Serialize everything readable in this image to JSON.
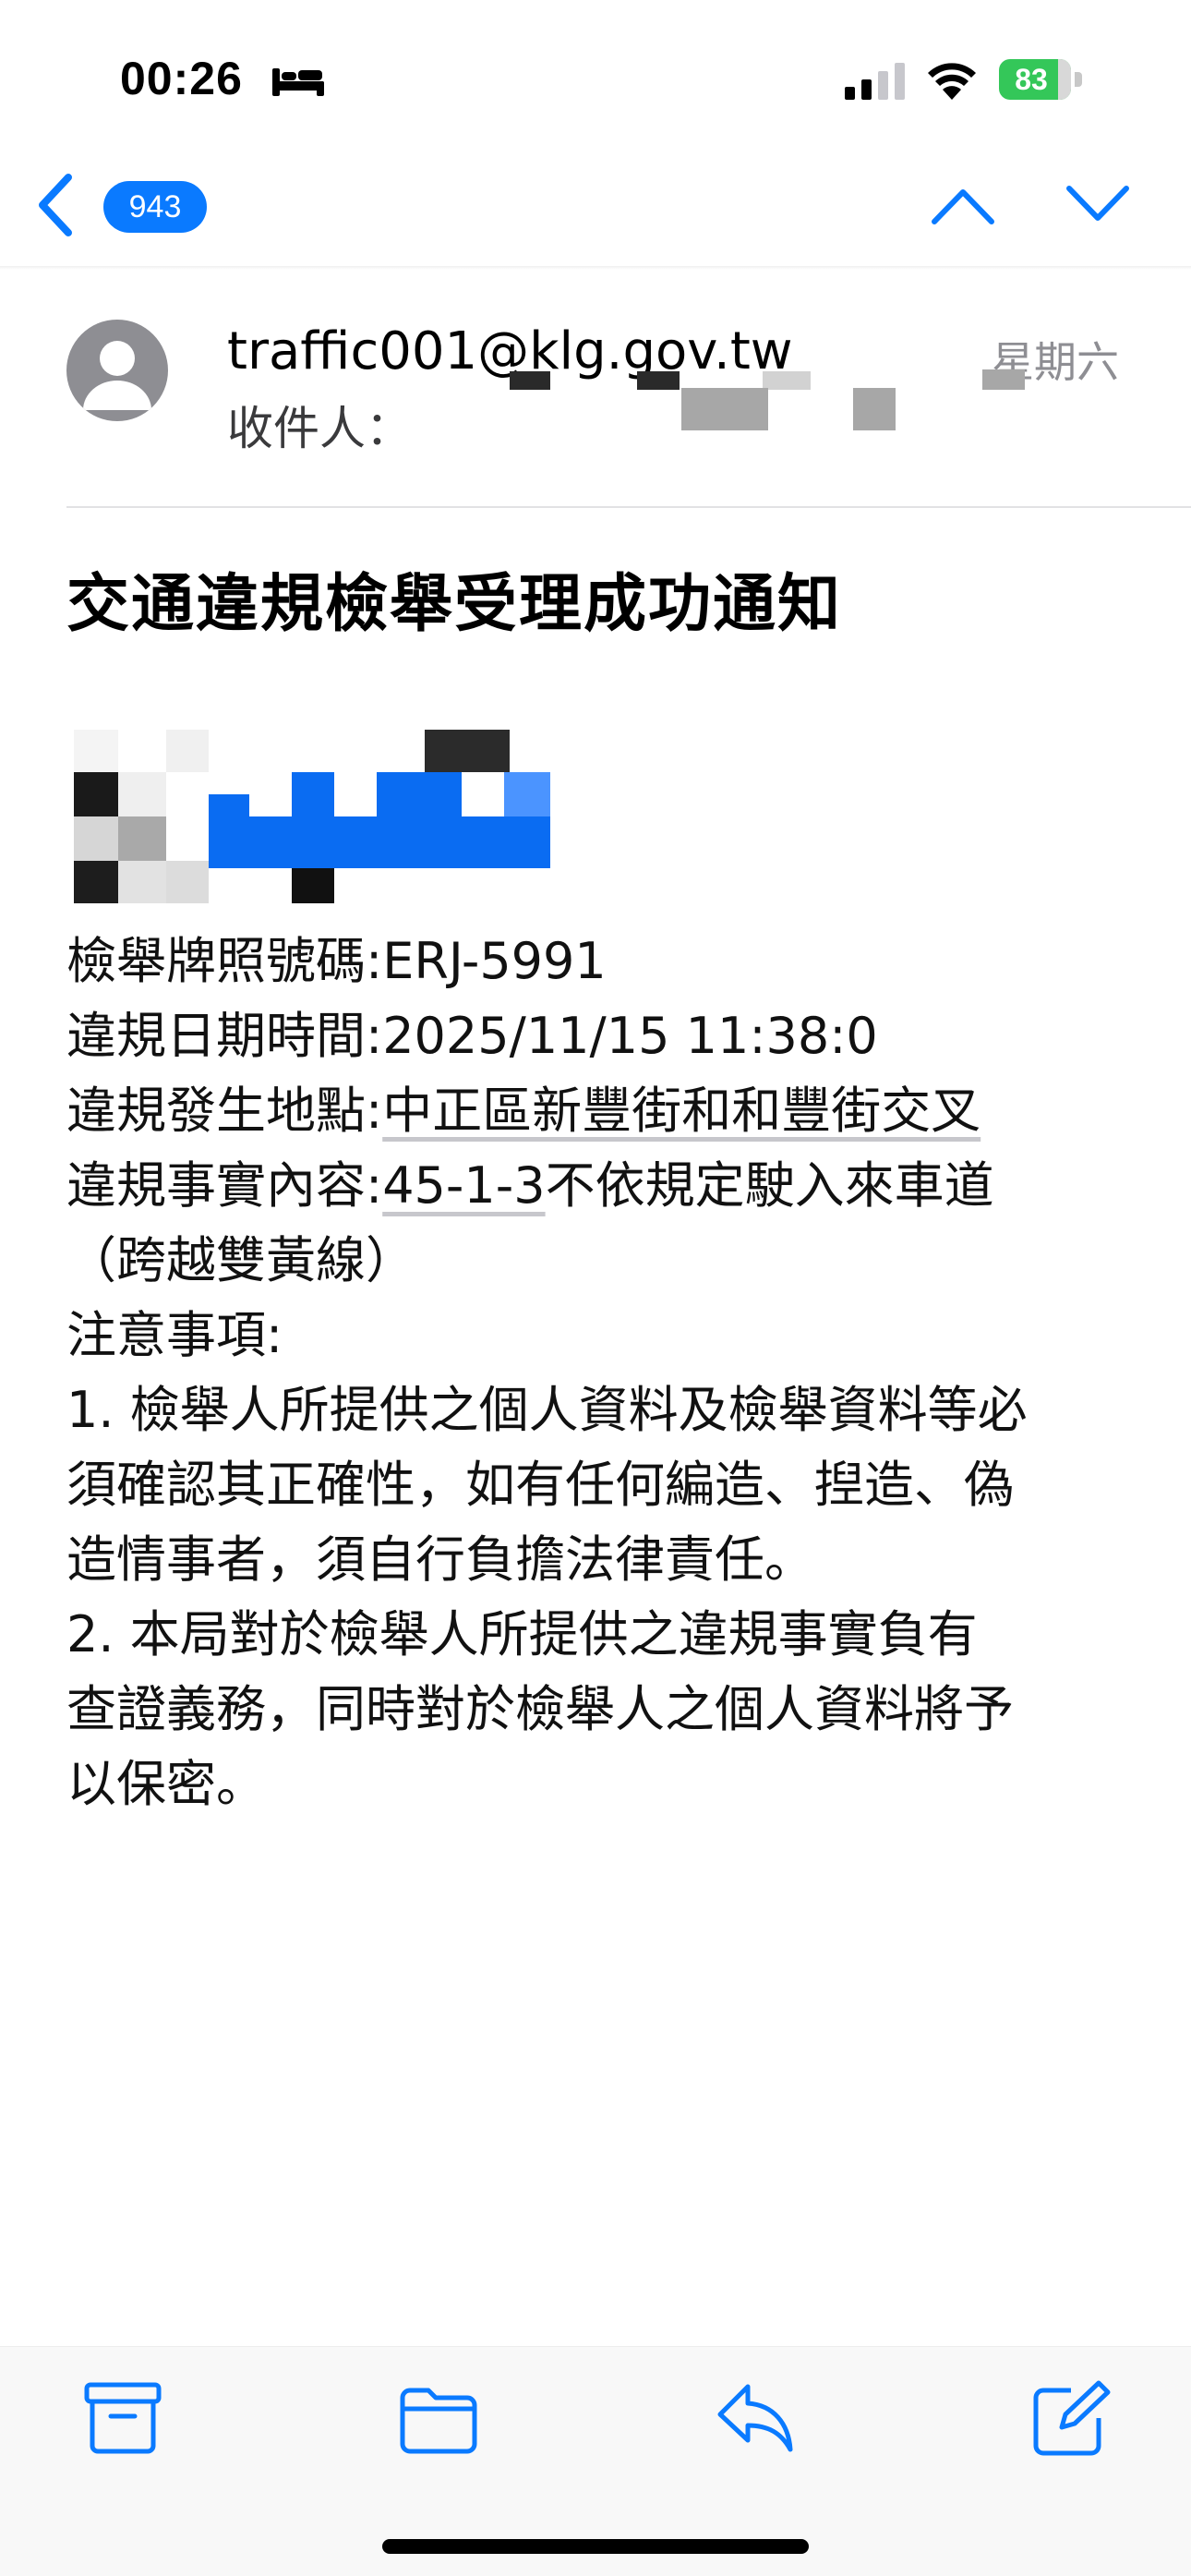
{
  "status_bar": {
    "time": "00:26",
    "battery": "83"
  },
  "nav": {
    "back_badge": "943"
  },
  "message": {
    "sender": "traffic001@klg.gov.tw",
    "date": "星期六",
    "recipient_label": "收件人：",
    "subject": "交通違規檢舉受理成功通知",
    "body": {
      "plate_label": "檢舉牌照號碼:",
      "plate_value": "ERJ-5991",
      "datetime_label": "違規日期時間:",
      "datetime_value": "2025/11/15 11:38:0",
      "location_label": "違規發生地點:",
      "location_value": "中正區新豐街和和豐街交叉",
      "fact_label": "違規事實內容:",
      "fact_code": "45-1-3",
      "fact_value": "不依規定駛入來車道",
      "fact_note": "（跨越雙黃線）",
      "notes_title": "注意事項:",
      "note1_line1": "1. 檢舉人所提供之個人資料及檢舉資料等必",
      "note1_line2": "須確認其正確性，如有任何編造、揑造、偽",
      "note1_line3": "造情事者，須自行負擔法律責任。",
      "note2_line1": "2. 本局對於檢舉人所提供之違規事實負有",
      "note2_line2": "查證義務，同時對於檢舉人之個人資料將予",
      "note2_line3": "以保密。"
    }
  },
  "icons": {
    "status": [
      "bed-icon",
      "cellular-signal-icon",
      "wifi-icon",
      "battery-icon"
    ],
    "nav": [
      "chevron-left-icon",
      "chevron-up-icon",
      "chevron-down-icon"
    ],
    "toolbar": [
      "archive-icon",
      "folder-icon",
      "reply-icon",
      "compose-icon"
    ]
  },
  "colors": {
    "accent": "#0a7aff",
    "battery": "#34c759",
    "secondary_text": "#8e8e93"
  }
}
